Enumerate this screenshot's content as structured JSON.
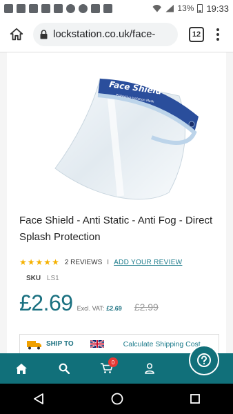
{
  "status_bar": {
    "battery_percent": "13%",
    "time": "19:33",
    "icons": [
      "facebook-icon",
      "mail-icon",
      "mail-icon",
      "youtube-icon",
      "inbox-icon",
      "soccer-icon",
      "sync-icon",
      "instagram-icon",
      "instagram-icon"
    ]
  },
  "browser": {
    "url": "lockstation.co.uk/face-",
    "tab_count": "12"
  },
  "product": {
    "title": "Face Shield - Anti Static - Anti Fog - Direct Splash Protection",
    "image_text": "Face Shield",
    "image_subtext": "Protective Isolation Mask",
    "rating": 5,
    "reviews_label": "2 REVIEWS",
    "separator": "I",
    "add_review_label": "ADD YOUR REVIEW",
    "sku_label": "SKU",
    "sku_value": "LS1",
    "price": "£2.69",
    "excl_vat_label": "Excl. VAT:",
    "excl_vat_value": "£2.69",
    "old_price": "£2.99"
  },
  "shipping": {
    "ship_to_label": "SHIP TO",
    "calculate_label": "Calculate Shipping Cost"
  },
  "bottom_nav": {
    "cart_count": "0",
    "items": [
      "home-icon",
      "search-icon",
      "cart-icon",
      "user-icon",
      "menu-icon"
    ]
  },
  "colors": {
    "accent": "#11707a",
    "price": "#1a7080",
    "star": "#f5b100",
    "badge": "#e53935"
  }
}
